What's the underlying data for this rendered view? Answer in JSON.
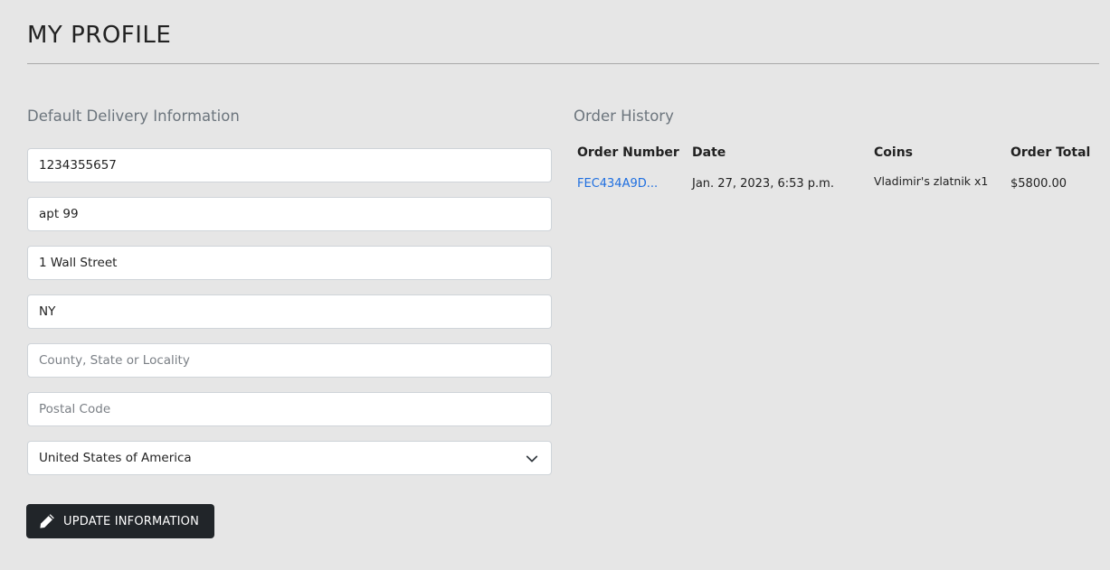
{
  "page": {
    "title": "MY PROFILE"
  },
  "delivery": {
    "heading": "Default Delivery Information",
    "fields": [
      {
        "name": "phone",
        "value": "1234355657",
        "placeholder": ""
      },
      {
        "name": "street_address1",
        "value": "apt 99",
        "placeholder": ""
      },
      {
        "name": "street_address2",
        "value": "1 Wall Street",
        "placeholder": ""
      },
      {
        "name": "town_or_city",
        "value": "NY",
        "placeholder": ""
      },
      {
        "name": "county",
        "value": "",
        "placeholder": "County, State or Locality"
      },
      {
        "name": "postcode",
        "value": "",
        "placeholder": "Postal Code"
      }
    ],
    "country": {
      "selected": "United States of America",
      "icon": "chevron-down-icon"
    },
    "update_button": {
      "label": "UPDATE INFORMATION",
      "icon": "pencil-icon"
    }
  },
  "history": {
    "heading": "Order History",
    "columns": [
      "Order Number",
      "Date",
      "Coins",
      "Order Total"
    ],
    "orders": [
      {
        "order_number": "FEC434A9D...",
        "date": "Jan. 27, 2023, 6:53 p.m.",
        "coins": "Vladimir's zlatnik x1",
        "total": "$5800.00"
      }
    ]
  },
  "colors": {
    "background": "#e6e6e6",
    "button": "#212529",
    "link": "#1f6fe0",
    "heading_muted": "#6c757d"
  }
}
